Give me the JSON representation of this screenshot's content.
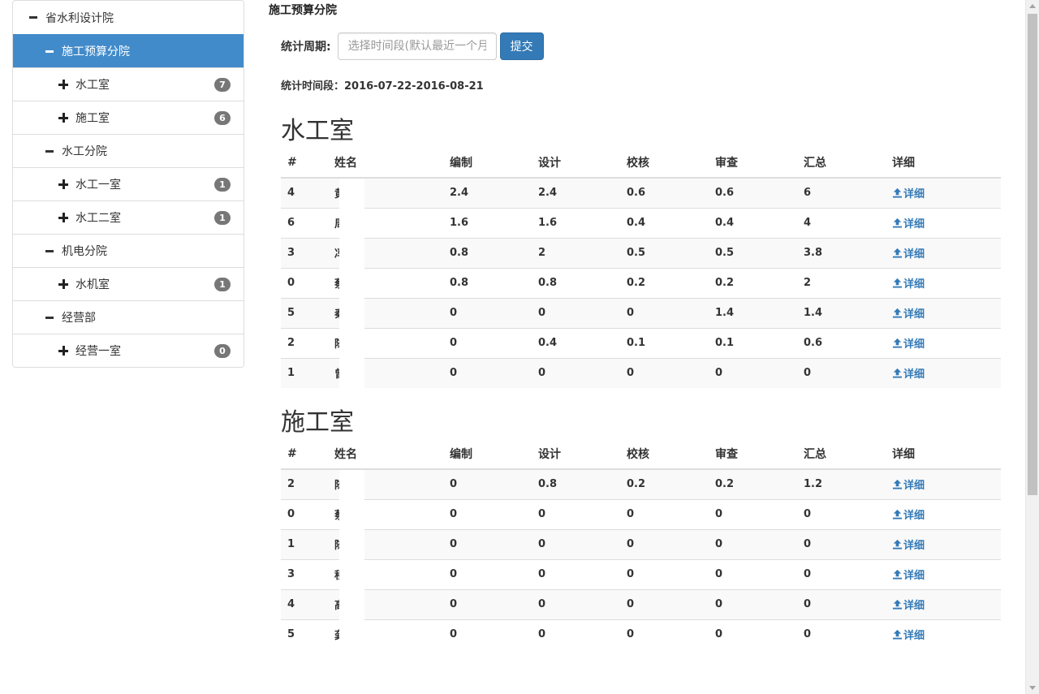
{
  "sidebar": {
    "items": [
      {
        "label": "省水利设计院",
        "level": 0,
        "sign": "minus",
        "active": false,
        "badge": null
      },
      {
        "label": "施工预算分院",
        "level": 1,
        "sign": "minus",
        "active": true,
        "badge": null
      },
      {
        "label": "水工室",
        "level": 2,
        "sign": "plus",
        "active": false,
        "badge": "7"
      },
      {
        "label": "施工室",
        "level": 2,
        "sign": "plus",
        "active": false,
        "badge": "6"
      },
      {
        "label": "水工分院",
        "level": 1,
        "sign": "minus",
        "active": false,
        "badge": null
      },
      {
        "label": "水工一室",
        "level": 2,
        "sign": "plus",
        "active": false,
        "badge": "1"
      },
      {
        "label": "水工二室",
        "level": 2,
        "sign": "plus",
        "active": false,
        "badge": "1"
      },
      {
        "label": "机电分院",
        "level": 1,
        "sign": "minus",
        "active": false,
        "badge": null
      },
      {
        "label": "水机室",
        "level": 2,
        "sign": "plus",
        "active": false,
        "badge": "1"
      },
      {
        "label": "经营部",
        "level": 1,
        "sign": "minus",
        "active": false,
        "badge": null
      },
      {
        "label": "经营一室",
        "level": 2,
        "sign": "plus",
        "active": false,
        "badge": "0"
      }
    ]
  },
  "main": {
    "title": "施工预算分院",
    "filter": {
      "label": "统计周期:",
      "placeholder": "选择时间段(默认最近一个月)",
      "submit_label": "提交"
    },
    "period": "统计时间段：2016-07-22-2016-08-21",
    "columns": [
      "#",
      "姓名",
      "编制",
      "设计",
      "校核",
      "审查",
      "汇总",
      "详细"
    ],
    "detail_label": "详细",
    "sections": [
      {
        "title": "水工室",
        "rows": [
          [
            "4",
            "黄",
            "2.4",
            "2.4",
            "0.6",
            "0.6",
            "6"
          ],
          [
            "6",
            "周",
            "1.6",
            "1.6",
            "0.4",
            "0.4",
            "4"
          ],
          [
            "3",
            "冯",
            "0.8",
            "2",
            "0.5",
            "0.5",
            "3.8"
          ],
          [
            "0",
            "蔡",
            "0.8",
            "0.8",
            "0.2",
            "0.2",
            "2"
          ],
          [
            "5",
            "秦",
            "0",
            "0",
            "0",
            "1.4",
            "1.4"
          ],
          [
            "2",
            "陈",
            "0",
            "0.4",
            "0.1",
            "0.1",
            "0.6"
          ],
          [
            "1",
            "曾",
            "0",
            "0",
            "0",
            "0",
            "0"
          ]
        ]
      },
      {
        "title": "施工室",
        "rows": [
          [
            "2",
            "陈",
            "0",
            "0.8",
            "0.2",
            "0.2",
            "1.2"
          ],
          [
            "0",
            "蔡",
            "0",
            "0",
            "0",
            "0",
            "0"
          ],
          [
            "1",
            "陈",
            "0",
            "0",
            "0",
            "0",
            "0"
          ],
          [
            "3",
            "程",
            "0",
            "0",
            "0",
            "0",
            "0"
          ],
          [
            "4",
            "高",
            "0",
            "0",
            "0",
            "0",
            "0"
          ],
          [
            "5",
            "龚",
            "0",
            "0",
            "0",
            "0",
            "0"
          ]
        ]
      }
    ]
  },
  "colors": {
    "accent": "#337ab7",
    "active_bg": "#428bca",
    "badge": "#777777"
  }
}
